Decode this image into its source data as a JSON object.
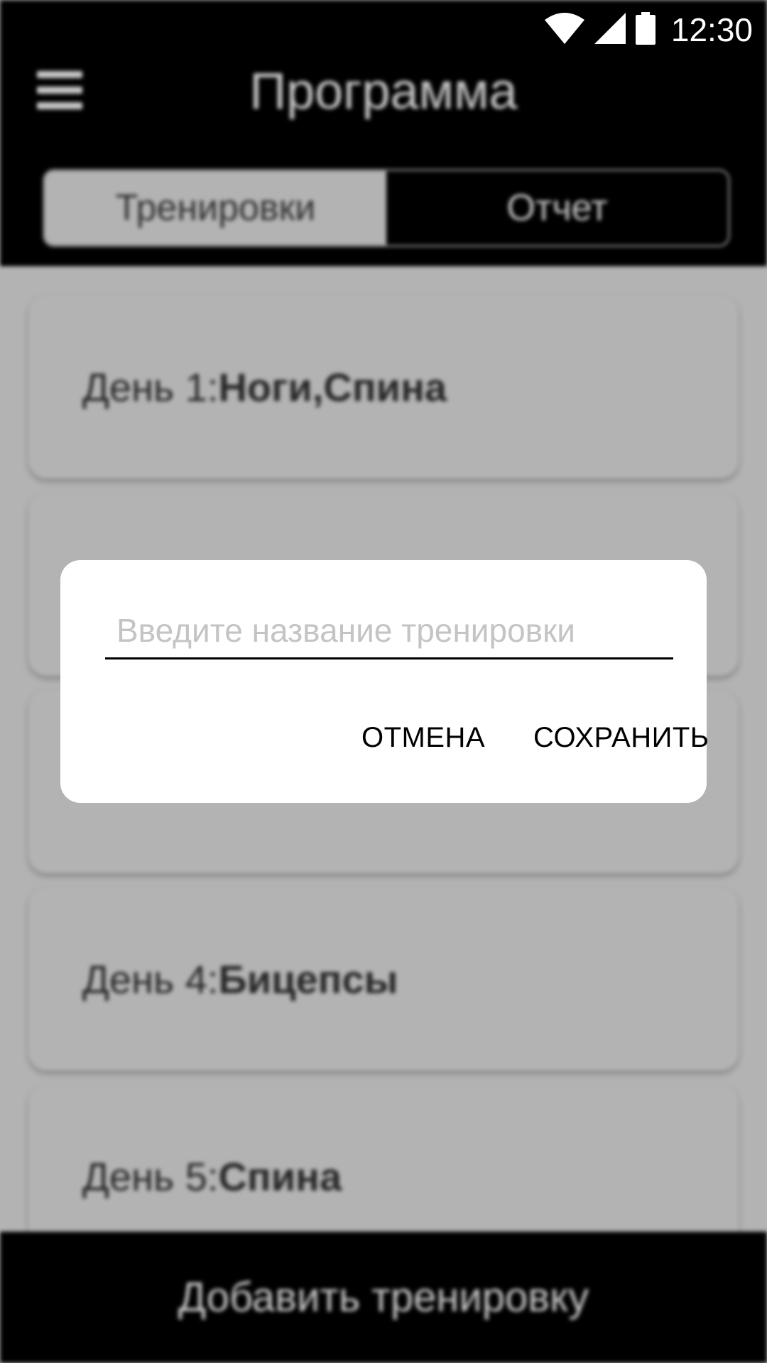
{
  "status_bar": {
    "time": "12:30",
    "icons": [
      "wifi-icon",
      "cellular-signal-icon",
      "battery-icon"
    ]
  },
  "header": {
    "title": "Программа",
    "menu_icon": "hamburger-menu-icon"
  },
  "tabs": [
    {
      "label": "Тренировки",
      "active": true
    },
    {
      "label": "Отчет",
      "active": false
    }
  ],
  "workouts": [
    {
      "day": "День 1: ",
      "muscles": "Ноги,Спина"
    },
    {
      "day": "",
      "muscles": ""
    },
    {
      "day": "",
      "muscles": ""
    },
    {
      "day": "День 4: ",
      "muscles": "Бицепсы"
    },
    {
      "day": "День 5: ",
      "muscles": "Спина"
    }
  ],
  "bottom_button": {
    "label": "Добавить тренировку"
  },
  "dialog": {
    "input_placeholder": "Введите название тренировки",
    "input_value": "",
    "cancel_label": "ОТМЕНА",
    "save_label": "СОХРАНИТЬ"
  },
  "colors": {
    "bar_background": "#000000",
    "overlay_background": "#b3b3b3",
    "dialog_background": "#ffffff"
  }
}
